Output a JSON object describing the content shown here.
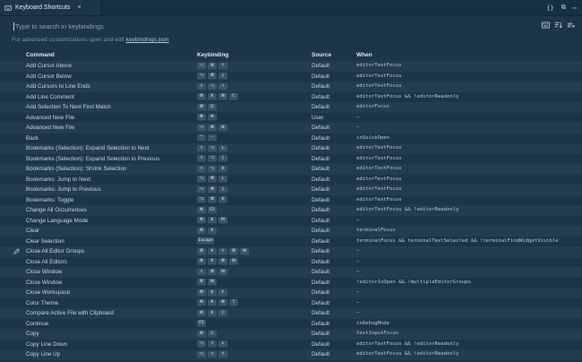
{
  "tab": {
    "label": "Keyboard Shortcuts",
    "close": "×",
    "icon": "keyboard-icon"
  },
  "editor_actions": [
    "{}",
    "⧉",
    "⋯"
  ],
  "search": {
    "placeholder": "Type to search in keybindings"
  },
  "hint": {
    "prefix": "For advanced customizations open and edit ",
    "link": "keybindings.json"
  },
  "columns": {
    "command": "Command",
    "keybinding": "Keybinding",
    "source": "Source",
    "when": "When"
  },
  "colors": {
    "background": "#1d3646",
    "row_alt": "#223d4e",
    "key_bg": "#3a5466",
    "tab_bar": "#163042"
  },
  "rows": [
    {
      "command": "Add Cursor Above",
      "keys": [
        "⌥",
        "⌘",
        "↑"
      ],
      "source": "Default",
      "when": "editorTextFocus"
    },
    {
      "command": "Add Cursor Below",
      "keys": [
        "⌥",
        "⌘",
        "↓"
      ],
      "source": "Default",
      "when": "editorTextFocus"
    },
    {
      "command": "Add Cursors to Line Ends",
      "keys": [
        "⇧",
        "⌥",
        "I"
      ],
      "source": "Default",
      "when": "editorTextFocus"
    },
    {
      "command": "Add Line Comment",
      "keys": [
        "⌘",
        "K",
        "⌘",
        "C"
      ],
      "source": "Default",
      "when": "editorTextFocus && !editorReadonly"
    },
    {
      "command": "Add Selection To Next Find Match",
      "keys": [
        "⌘",
        "D"
      ],
      "source": "Default",
      "when": "editorFocus"
    },
    {
      "command": "Advanced New File",
      "keys": [
        "⌘",
        "N"
      ],
      "source": "User",
      "when": "—"
    },
    {
      "command": "Advanced New File",
      "keys": [
        "⌥",
        "⌘",
        "N"
      ],
      "source": "Default",
      "when": "—"
    },
    {
      "command": "Back",
      "keys": [
        "^",
        "-"
      ],
      "source": "Default",
      "when": "inQuickOpen"
    },
    {
      "command": "Bookmarks (Selection): Expand Selection to Next",
      "keys": [
        "⇧",
        "⌥",
        "L"
      ],
      "source": "Default",
      "when": "editorTextFocus"
    },
    {
      "command": "Bookmarks (Selection): Expand Selection to Previous",
      "keys": [
        "⇧",
        "⌥",
        "J"
      ],
      "source": "Default",
      "when": "editorTextFocus"
    },
    {
      "command": "Bookmarks (Selection): Shrink Selection",
      "keys": [
        "⇧",
        "⌥",
        "K"
      ],
      "source": "Default",
      "when": "editorTextFocus"
    },
    {
      "command": "Bookmarks: Jump to Next",
      "keys": [
        "⌥",
        "⌘",
        "L"
      ],
      "source": "Default",
      "when": "editorTextFocus"
    },
    {
      "command": "Bookmarks: Jump to Previous",
      "keys": [
        "⌥",
        "⌘",
        "J"
      ],
      "source": "Default",
      "when": "editorTextFocus"
    },
    {
      "command": "Bookmarks: Toggle",
      "keys": [
        "⌥",
        "⌘",
        "K"
      ],
      "source": "Default",
      "when": "editorTextFocus"
    },
    {
      "command": "Change All Occurrences",
      "keys": [
        "⌘",
        "F2"
      ],
      "source": "Default",
      "when": "editorTextFocus && !editorReadonly"
    },
    {
      "command": "Change Language Mode",
      "keys": [
        "⌘",
        "K",
        "M"
      ],
      "source": "Default",
      "when": "—"
    },
    {
      "command": "Clear",
      "keys": [
        "⌘",
        "K"
      ],
      "source": "Default",
      "when": "terminalFocus"
    },
    {
      "command": "Clear Selection",
      "keys": [
        "Escape"
      ],
      "source": "Default",
      "when": "terminalFocus && terminalTextSelected && !terminalFindWidgetVisible"
    },
    {
      "command": "Close All Editor Groups",
      "keys": [
        "⌘",
        "K",
        "⇧",
        "⌘",
        "W"
      ],
      "source": "Default",
      "when": "—",
      "editing": true
    },
    {
      "command": "Close All Editors",
      "keys": [
        "⌘",
        "K",
        "⌘",
        "W"
      ],
      "source": "Default",
      "when": "—"
    },
    {
      "command": "Close Window",
      "keys": [
        "⇧",
        "⌘",
        "W"
      ],
      "source": "Default",
      "when": "—"
    },
    {
      "command": "Close Window",
      "keys": [
        "⌘",
        "W"
      ],
      "source": "Default",
      "when": "!editorIsOpen && !multipleEditorGroups"
    },
    {
      "command": "Close Workspace",
      "keys": [
        "⌘",
        "K",
        "F"
      ],
      "source": "Default",
      "when": "—"
    },
    {
      "command": "Color Theme",
      "keys": [
        "⌘",
        "K",
        "⌘",
        "T"
      ],
      "source": "Default",
      "when": "—"
    },
    {
      "command": "Compare Active File with Clipboard",
      "keys": [
        "⌘",
        "K",
        "C"
      ],
      "source": "Default",
      "when": "—"
    },
    {
      "command": "Continue",
      "keys": [
        "F5"
      ],
      "source": "Default",
      "when": "inDebugMode"
    },
    {
      "command": "Copy",
      "keys": [
        "⌘",
        "C"
      ],
      "source": "Default",
      "when": "textInputFocus"
    },
    {
      "command": "Copy Line Down",
      "keys": [
        "⌥",
        "⇧",
        "↓"
      ],
      "source": "Default",
      "when": "editorTextFocus && !editorReadonly"
    },
    {
      "command": "Copy Line Up",
      "keys": [
        "⌥",
        "⇧",
        "↑"
      ],
      "source": "Default",
      "when": "editorTextFocus && !editorReadonly"
    }
  ]
}
